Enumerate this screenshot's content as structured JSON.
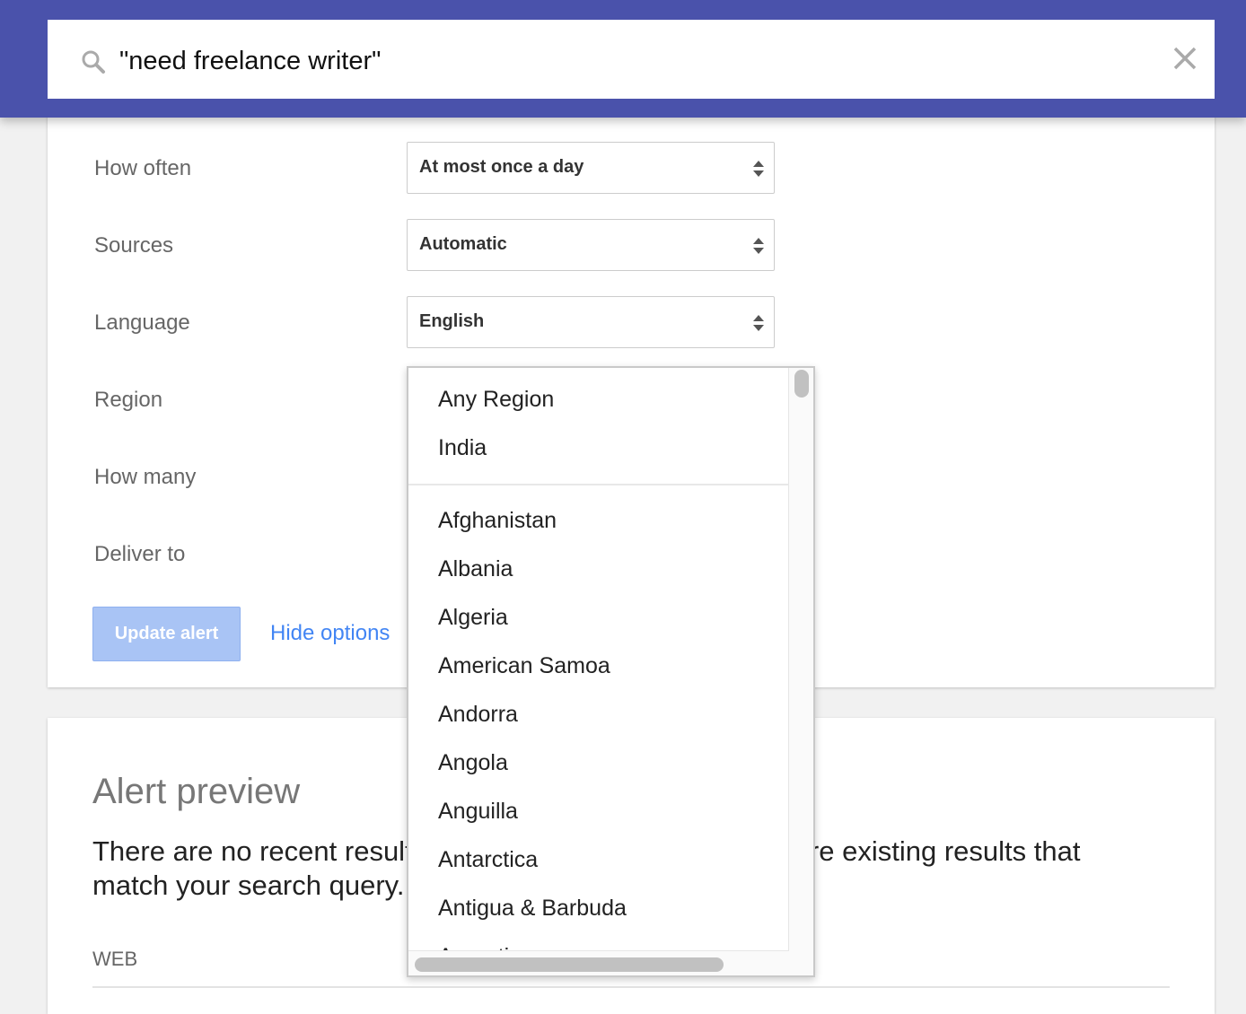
{
  "search": {
    "query": "\"need freelance writer\"",
    "search_icon": "search-icon",
    "clear_icon": "close-icon"
  },
  "colors": {
    "header": "#4a52ab",
    "link": "#4285f4",
    "button": "#a9c4f5"
  },
  "options": {
    "how_often": {
      "label": "How often",
      "value": "At most once a day"
    },
    "sources": {
      "label": "Sources",
      "value": "Automatic"
    },
    "language": {
      "label": "Language",
      "value": "English"
    },
    "region": {
      "label": "Region"
    },
    "how_many": {
      "label": "How many"
    },
    "deliver_to": {
      "label": "Deliver to"
    },
    "update_label": "Update alert",
    "hide_options_label": "Hide options"
  },
  "region_dropdown": {
    "top": [
      "Any Region",
      "India"
    ],
    "items": [
      "Afghanistan",
      "Albania",
      "Algeria",
      "American Samoa",
      "Andorra",
      "Angola",
      "Anguilla",
      "Antarctica",
      "Antigua & Barbuda",
      "Argentina"
    ]
  },
  "preview": {
    "title": "Alert preview",
    "message": "There are no recent results for your search query. Below are existing results that match your search query.",
    "section": "WEB"
  }
}
